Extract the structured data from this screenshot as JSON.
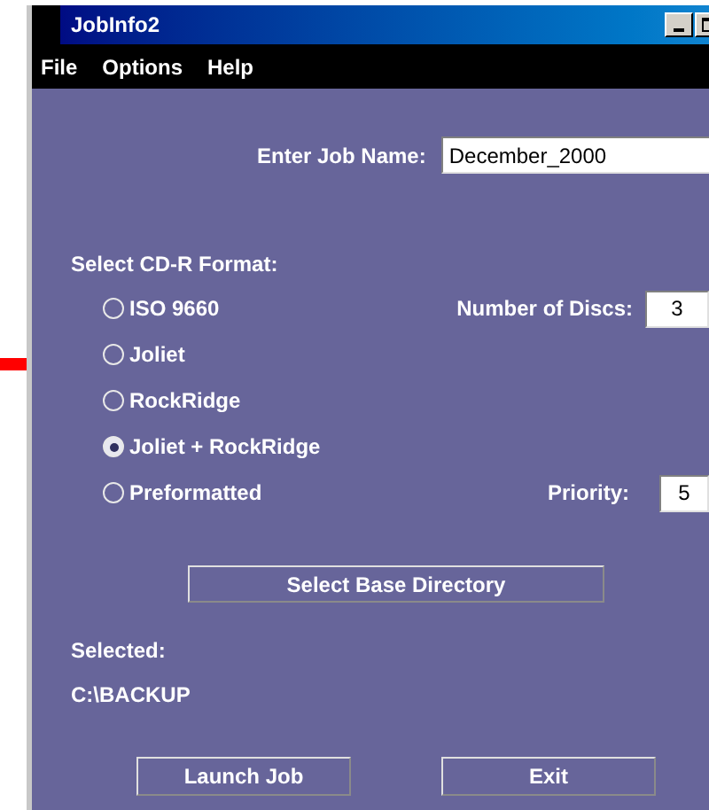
{
  "window": {
    "title": "JobInfo2"
  },
  "menu": [
    "File",
    "Options",
    "Help"
  ],
  "job_name": {
    "label": "Enter Job Name:",
    "value": "December_2000"
  },
  "format": {
    "label": "Select CD-R Format:",
    "options": [
      {
        "label": "ISO 9660",
        "selected": false
      },
      {
        "label": "Joliet",
        "selected": false
      },
      {
        "label": "RockRidge",
        "selected": false
      },
      {
        "label": "Joliet + RockRidge",
        "selected": true
      },
      {
        "label": "Preformatted",
        "selected": false
      }
    ]
  },
  "discs": {
    "label": "Number of Discs:",
    "value": "3"
  },
  "priority": {
    "label": "Priority:",
    "value": "5"
  },
  "select_dir_button": "Select Base Directory",
  "selected_label": "Selected:",
  "selected_path": "C:\\BACKUP",
  "buttons": [
    "Launch Job",
    "Exit"
  ]
}
